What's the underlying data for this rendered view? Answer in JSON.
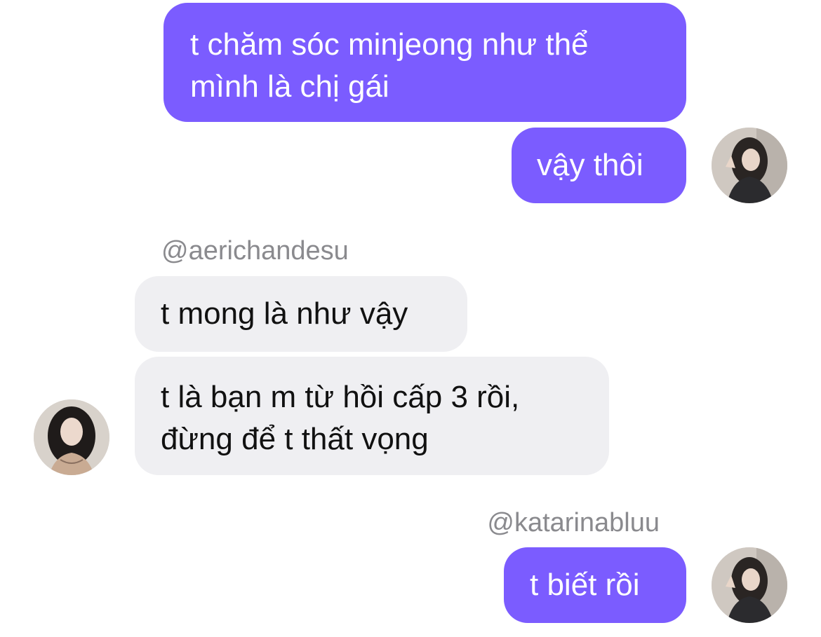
{
  "conversation": {
    "messages": [
      {
        "sender": "self",
        "text": "t chăm sóc minjeong như thể\nmình là chị gái"
      },
      {
        "sender": "self",
        "text": "vậy thôi"
      },
      {
        "sender": "other",
        "username": "@aerichandesu",
        "text": "t mong là như vậy"
      },
      {
        "sender": "other",
        "text": "t là bạn m từ hồi cấp 3 rồi,\nđừng để t thất vọng"
      },
      {
        "sender": "self",
        "username": "@katarinabluu",
        "text": "t biết rồi"
      }
    ]
  },
  "colors": {
    "outgoing_bubble": "#7b5cff",
    "incoming_bubble": "#efeff2",
    "username_text": "#8a8a8e"
  }
}
